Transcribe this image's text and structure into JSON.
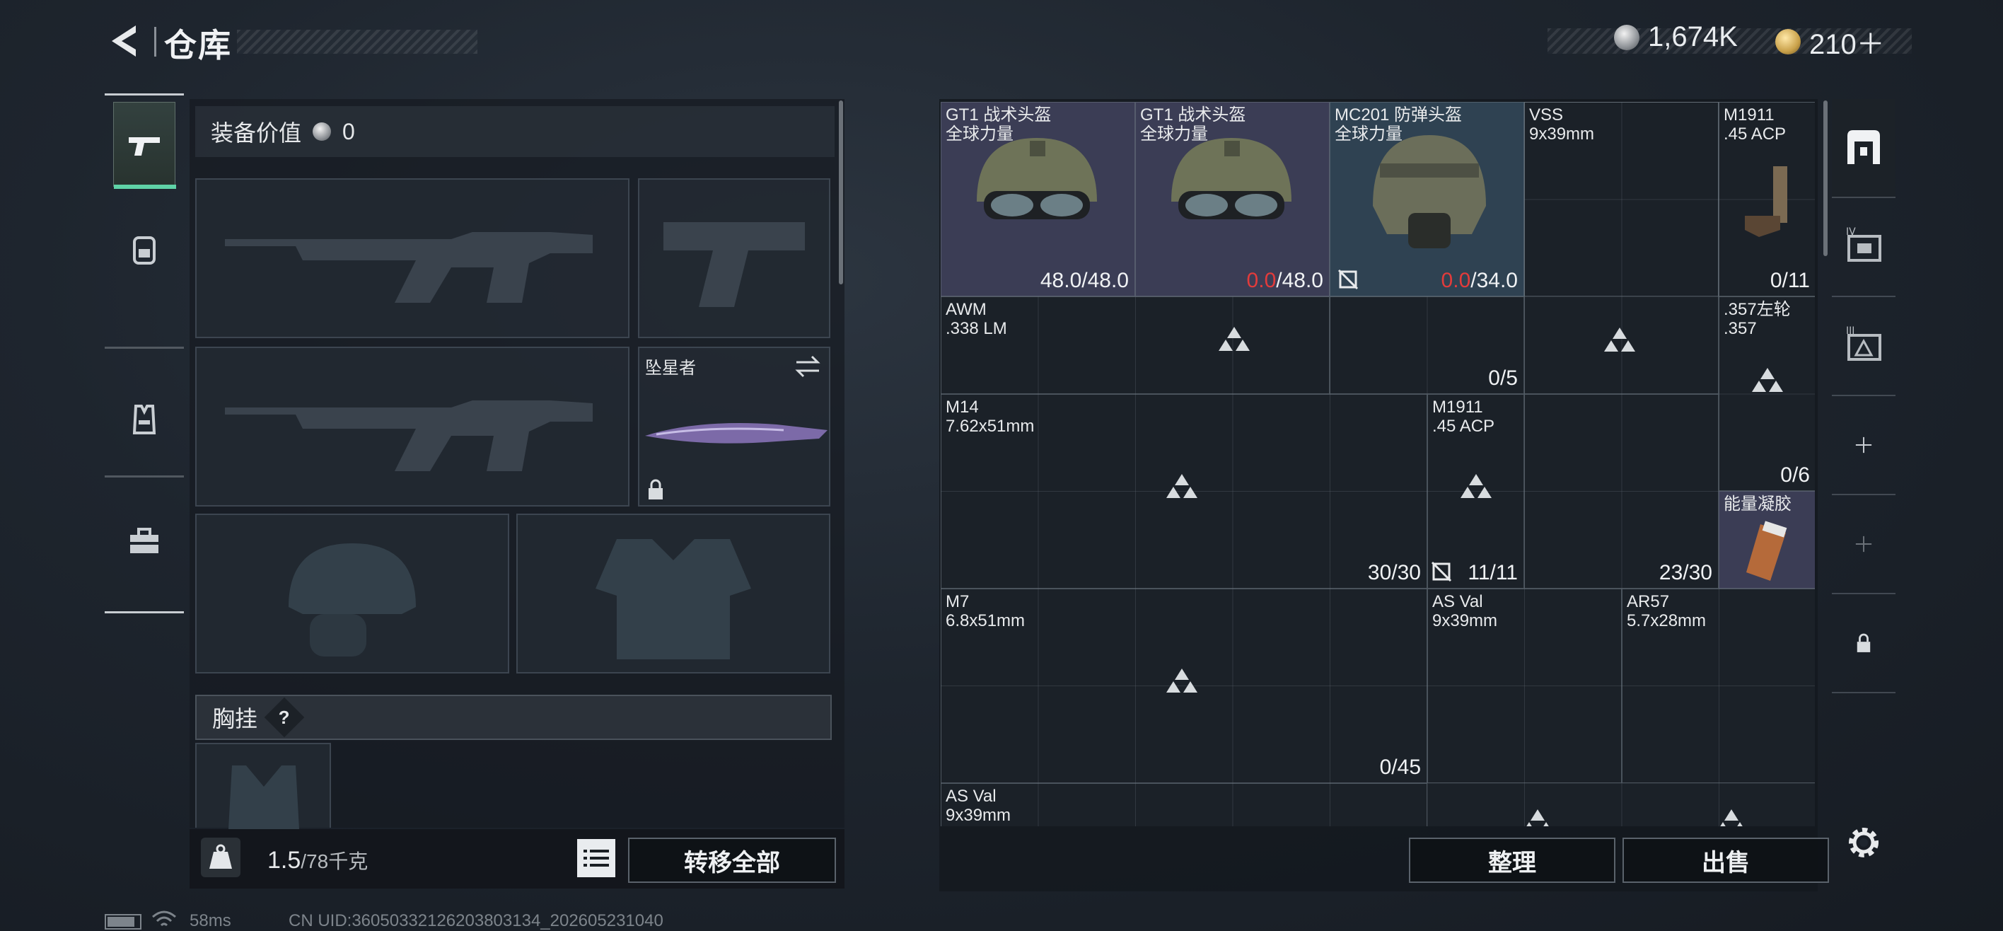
{
  "header": {
    "title": "仓库",
    "currency": [
      {
        "icon": "silver-coin-icon",
        "value": "1,674K"
      },
      {
        "icon": "gold-coin-icon",
        "value": "210＋"
      }
    ]
  },
  "left_tabs": [
    {
      "icon": "pistol-icon",
      "active": true
    },
    {
      "icon": "backpack-icon",
      "active": false
    },
    {
      "icon": "vest-icon",
      "active": false
    },
    {
      "icon": "toolbox-icon",
      "active": false
    }
  ],
  "equipment": {
    "value_label": "装备价值",
    "value": "0",
    "melee_name": "坠星者",
    "chest_rig_label": "胸挂",
    "chest_rig_help": "?"
  },
  "footer_left": {
    "weight": "1.5",
    "weight_max": "/78千克",
    "transfer_all": "转移全部"
  },
  "grid_items": [
    {
      "name": "GT1 战术头盔",
      "sub": "全球力量",
      "count": "48.0",
      "max": "/48.0",
      "red": false
    },
    {
      "name": "GT1 战术头盔",
      "sub": "全球力量",
      "count": "0.0",
      "max": "/48.0",
      "red": true
    },
    {
      "name": "MC201 防弹头盔",
      "sub": "全球力量",
      "count": "0.0",
      "max": "/34.0",
      "red": true
    },
    {
      "name": "VSS",
      "sub": "9x39mm",
      "count": "",
      "max": "",
      "red": false
    },
    {
      "name": "M1911",
      "sub": ".45 ACP",
      "count": "0/11",
      "max": "",
      "red": false
    },
    {
      "name": "AWM",
      "sub": ".338 LM",
      "count": "0/5",
      "max": "",
      "red": false
    },
    {
      "name": ".357左轮",
      "sub": ".357",
      "count": "0/6",
      "max": "",
      "red": false
    },
    {
      "name": "M14",
      "sub": "7.62x51mm",
      "count": "30/30",
      "max": "",
      "red": false
    },
    {
      "name": "M1911",
      "sub": ".45 ACP",
      "count": "11/11",
      "max": "",
      "red": false
    },
    {
      "name": "",
      "sub": "",
      "count": "23/30",
      "max": "",
      "red": false
    },
    {
      "name": "能量凝胶",
      "sub": "",
      "count": "",
      "max": "",
      "red": false
    },
    {
      "name": "M7",
      "sub": "6.8x51mm",
      "count": "0/45",
      "max": "",
      "red": false
    },
    {
      "name": "AS Val",
      "sub": "9x39mm",
      "count": "",
      "max": "",
      "red": false
    },
    {
      "name": "AR57",
      "sub": "5.7x28mm",
      "count": "",
      "max": "",
      "red": false
    },
    {
      "name": "AS Val",
      "sub": "9x39mm",
      "count": "",
      "max": "",
      "red": false
    }
  ],
  "footer_right": {
    "sort": "整理",
    "sell": "出售"
  },
  "right_tabs": [
    {
      "icon": "storage-box-icon"
    },
    {
      "icon": "storage-box-iv-icon"
    },
    {
      "icon": "storage-box-iii-icon"
    },
    {
      "icon": "add-icon"
    },
    {
      "icon": "add-icon"
    },
    {
      "icon": "lock-icon"
    },
    {
      "icon": "gear-icon"
    }
  ],
  "status_bar": {
    "ping": "58ms",
    "uid": "CN UID:3605033212620380313​4_202605231040"
  }
}
